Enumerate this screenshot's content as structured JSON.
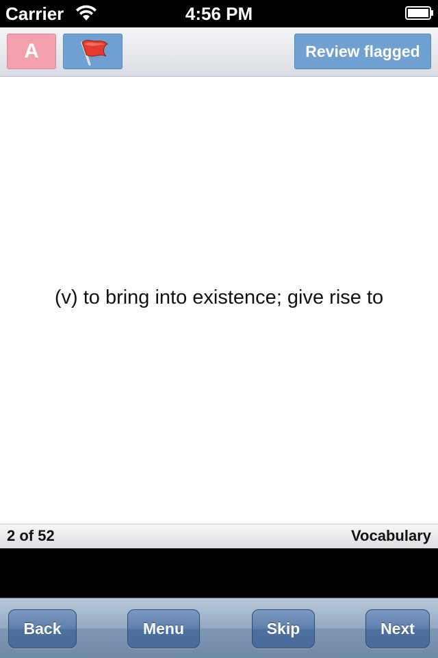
{
  "status_bar": {
    "carrier": "Carrier",
    "time": "4:56 PM",
    "wifi_icon": "wifi-icon",
    "battery_icon": "battery-icon"
  },
  "toolbar": {
    "font_button_label": "A",
    "flag_icon": "red-flag-icon",
    "review_flagged_label": "Review flagged"
  },
  "card": {
    "definition": "(v) to bring into existence; give rise to"
  },
  "info_bar": {
    "progress": "2 of 52",
    "category": "Vocabulary"
  },
  "nav": {
    "back_label": "Back",
    "menu_label": "Menu",
    "skip_label": "Skip",
    "next_label": "Next"
  },
  "colors": {
    "status_bar_bg": "#000000",
    "font_button_bg": "#f29fae",
    "accent_button_bg": "#6ea0d1",
    "flag_red": "#e23a2c",
    "nav_button_bg": "#5c7fab"
  }
}
